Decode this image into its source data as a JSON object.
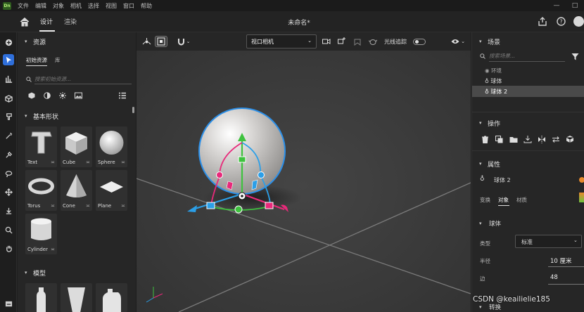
{
  "app": {
    "logo_text": "Dn",
    "document_title": "未命名*"
  },
  "menu": [
    "文件",
    "编辑",
    "对象",
    "相机",
    "选择",
    "视图",
    "窗口",
    "帮助"
  ],
  "window_controls": [
    "—",
    "□"
  ],
  "tabs": [
    {
      "label": "设计",
      "active": true
    },
    {
      "label": "渲染",
      "active": false
    }
  ],
  "tools": [
    "add-icon",
    "select-arrow-icon",
    "chart-icon",
    "cube-icon",
    "paint-brush-icon",
    "magic-wand-icon",
    "eyedropper-icon",
    "lasso-icon",
    "move-icon",
    "stamp-icon",
    "search-icon",
    "hand-icon"
  ],
  "assets": {
    "header": "资源",
    "subtabs": [
      "初始资源",
      "库"
    ],
    "search_placeholder": "搜索初始资源...",
    "filter_icons": [
      "cube-icon",
      "sphere-half-icon",
      "light-icon",
      "image-icon"
    ],
    "section_basic": "基本形状",
    "shapes": [
      {
        "label": "Text"
      },
      {
        "label": "Cube"
      },
      {
        "label": "Sphere"
      },
      {
        "label": "Torus"
      },
      {
        "label": "Cone"
      },
      {
        "label": "Plane"
      },
      {
        "label": "Cylinder"
      }
    ],
    "section_models": "模型"
  },
  "viewport": {
    "camera_select": "视口相机",
    "ray_tracing_label": "光线追踪",
    "ray_tracing_on": false
  },
  "scene": {
    "header": "场景",
    "search_placeholder": "搜索场景...",
    "items": [
      {
        "label": "环境",
        "selected": false
      },
      {
        "label": "球体",
        "selected": false
      },
      {
        "label": "球体 2",
        "selected": true
      }
    ]
  },
  "actions": {
    "header": "操作",
    "icons": [
      "delete-icon",
      "duplicate-icon",
      "folder-icon",
      "drop-to-floor-icon",
      "mirror-icon",
      "swap-icon",
      "cube-add-icon"
    ]
  },
  "properties": {
    "header": "属性",
    "object_name": "球体 2",
    "subtabs": [
      {
        "label": "变换",
        "active": false
      },
      {
        "label": "对象",
        "active": true
      },
      {
        "label": "材质",
        "active": false
      }
    ],
    "group": "球体",
    "fields": [
      {
        "label": "类型",
        "value": "标准"
      },
      {
        "label": "半径",
        "value": "10 厘米"
      },
      {
        "label": "边",
        "value": "48"
      }
    ],
    "next_group": "转换"
  },
  "watermark": "CSDN @keailielie185",
  "colors": {
    "accent": "#2f6fdb",
    "sphere": "#d9d6d4",
    "gizmo_blue": "#2b9fe8",
    "gizmo_pink": "#e8297a",
    "gizmo_green": "#3fc23f"
  }
}
